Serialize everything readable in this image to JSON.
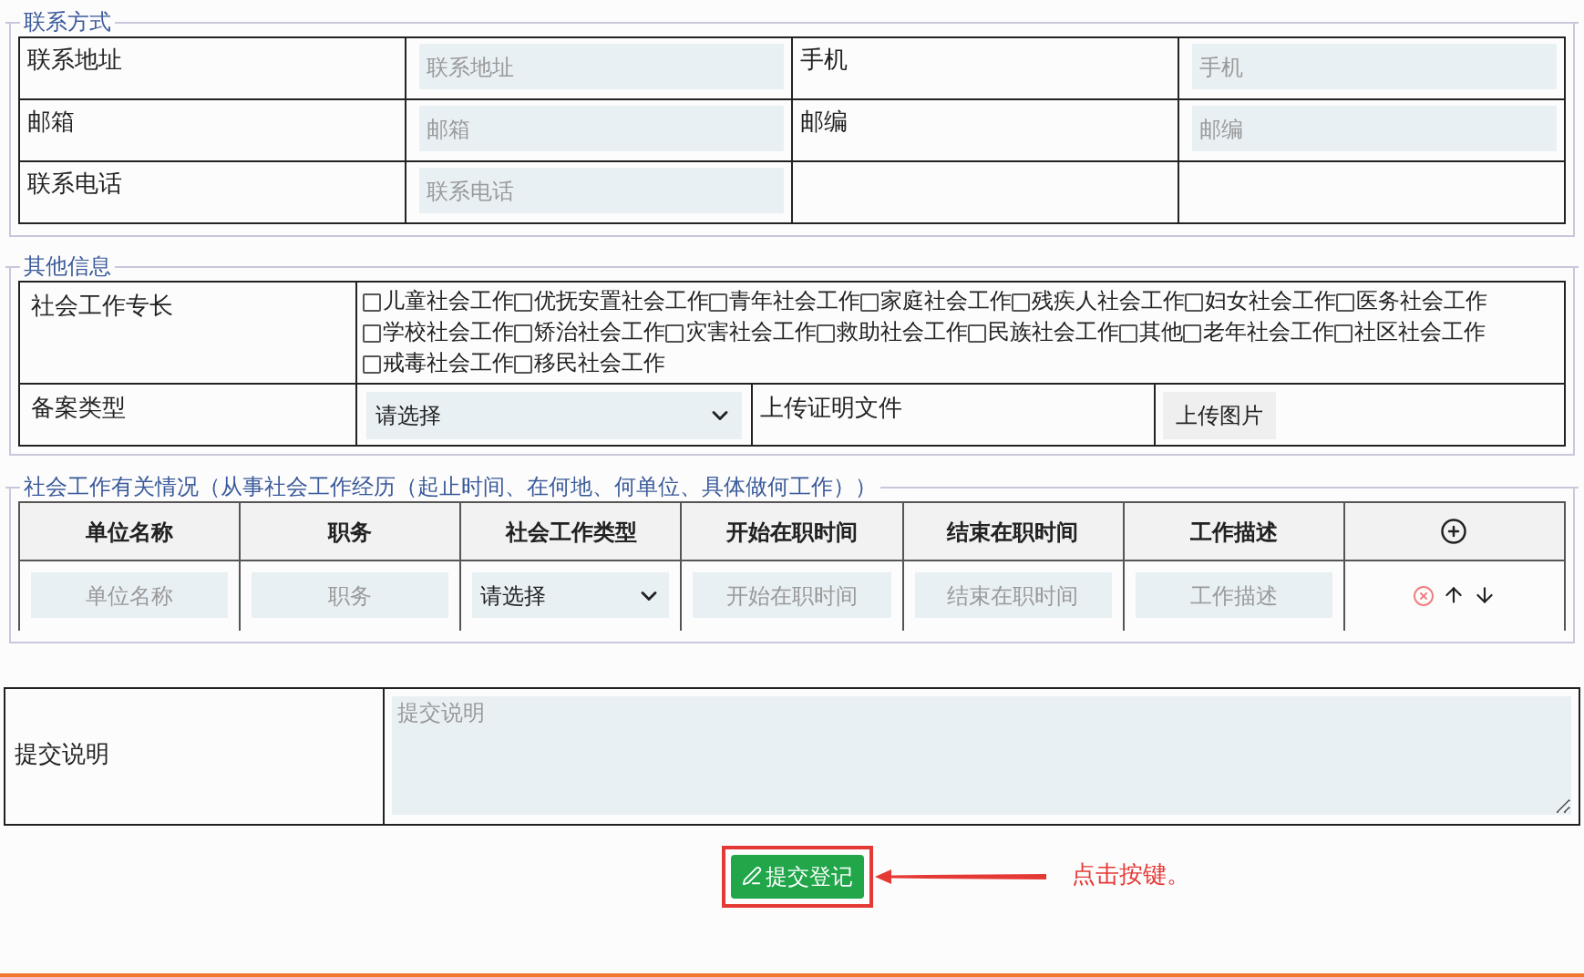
{
  "contact": {
    "legend": "联系方式",
    "rows": [
      {
        "cells": [
          {
            "kind": "label",
            "text": "联系地址"
          },
          {
            "kind": "input",
            "placeholder": "联系地址"
          },
          {
            "kind": "label",
            "text": "手机"
          },
          {
            "kind": "input",
            "placeholder": "手机"
          }
        ]
      },
      {
        "cells": [
          {
            "kind": "label",
            "text": "邮箱"
          },
          {
            "kind": "input",
            "placeholder": "邮箱"
          },
          {
            "kind": "label",
            "text": "邮编"
          },
          {
            "kind": "input",
            "placeholder": "邮编"
          }
        ]
      },
      {
        "cells": [
          {
            "kind": "label",
            "text": "联系电话"
          },
          {
            "kind": "input",
            "placeholder": "联系电话"
          },
          {
            "kind": "empty"
          },
          {
            "kind": "empty"
          }
        ]
      }
    ]
  },
  "other": {
    "legend": "其他信息",
    "specialty_label": "社会工作专长",
    "specialties": [
      {
        "label": "儿童社会工作",
        "checked": false
      },
      {
        "label": "优抚安置社会工作",
        "checked": false
      },
      {
        "label": "青年社会工作",
        "checked": false
      },
      {
        "label": "家庭社会工作",
        "checked": false
      },
      {
        "label": "残疾人社会工作",
        "checked": false
      },
      {
        "label": "妇女社会工作",
        "checked": false
      },
      {
        "label": "医务社会工作",
        "checked": false
      },
      {
        "label": "学校社会工作",
        "checked": false
      },
      {
        "label": "矫治社会工作",
        "checked": false
      },
      {
        "label": "灾害社会工作",
        "checked": false
      },
      {
        "label": "救助社会工作",
        "checked": false
      },
      {
        "label": "民族社会工作",
        "checked": false
      },
      {
        "label": "其他",
        "checked": false
      },
      {
        "label": "老年社会工作",
        "checked": false
      },
      {
        "label": "社区社会工作",
        "checked": false
      },
      {
        "label": "戒毒社会工作",
        "checked": false
      },
      {
        "label": "移民社会工作",
        "checked": false
      }
    ],
    "filing_label": "备案类型",
    "filing_select": "请选择",
    "upload_label": "上传证明文件",
    "upload_button": "上传图片"
  },
  "experience": {
    "legend": "社会工作有关情况（从事社会工作经历（起止时间、在何地、何单位、具体做何工作））",
    "columns": [
      "单位名称",
      "职务",
      "社会工作类型",
      "开始在职时间",
      "结束在职时间",
      "工作描述"
    ],
    "rows": [
      {
        "cells": [
          {
            "kind": "input",
            "placeholder": "单位名称"
          },
          {
            "kind": "input",
            "placeholder": "职务"
          },
          {
            "kind": "select",
            "value": "请选择"
          },
          {
            "kind": "input",
            "placeholder": "开始在职时间"
          },
          {
            "kind": "input",
            "placeholder": "结束在职时间"
          },
          {
            "kind": "input",
            "placeholder": "工作描述"
          }
        ]
      }
    ]
  },
  "note": {
    "label": "提交说明",
    "placeholder": "提交说明"
  },
  "submit_button": "提交登记",
  "callout": "点击按键。"
}
